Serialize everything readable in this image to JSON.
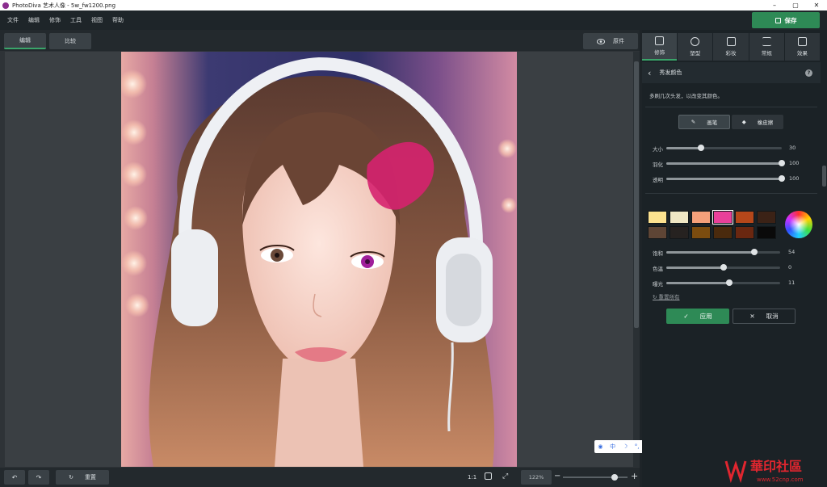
{
  "window": {
    "title": "PhotoDiva 艺术人像 - 5w_fw1200.png",
    "controls": [
      "–",
      "▢",
      "✕"
    ]
  },
  "menu": [
    "文件",
    "编辑",
    "修饰",
    "工具",
    "视图",
    "帮助"
  ],
  "save_label": "保存",
  "view_tabs": [
    "编辑",
    "比较"
  ],
  "original_label": "原件",
  "bottom": {
    "reset_label": "重置",
    "ratio_label": "1:1",
    "zoom_value": "122%",
    "zoom_fraction": 0.8
  },
  "ime": {
    "items": [
      "中",
      "☽",
      "°,",
      "🎤",
      "👤",
      "▦"
    ]
  },
  "tool_tabs": [
    {
      "label": "修饰",
      "icon": "brush-face-icon"
    },
    {
      "label": "塑型",
      "icon": "globe-icon"
    },
    {
      "label": "彩妆",
      "icon": "makeup-icon"
    },
    {
      "label": "常规",
      "icon": "sliders-icon"
    },
    {
      "label": "效果",
      "icon": "effects-icon"
    }
  ],
  "panel": {
    "section_title": "秀发颜色",
    "hint": "多刷几次头发，以改变其颜色。",
    "brush_label": "画笔",
    "eraser_label": "橡皮擦",
    "sliders_top": [
      {
        "label": "大小",
        "value": 30,
        "fraction": 0.3
      },
      {
        "label": "羽化",
        "value": 100,
        "fraction": 1.0
      },
      {
        "label": "透明",
        "value": 100,
        "fraction": 1.0
      }
    ],
    "swatches": [
      "#fce28f",
      "#efe7c4",
      "#f4a07a",
      "#e8409a",
      "#b5471a",
      "#3b2216",
      "#5e4535",
      "#262220",
      "#7b4c0f",
      "#4a2a0d",
      "#6a2710",
      "#0a0a0a"
    ],
    "selected_swatch": 3,
    "sliders_bottom": [
      {
        "label": "饱和",
        "value": 54,
        "fraction": 0.77
      },
      {
        "label": "色温",
        "value": 0,
        "fraction": 0.5
      },
      {
        "label": "曝光",
        "value": 11,
        "fraction": 0.55
      }
    ],
    "reset_all_label": "重置所有",
    "apply_label": "应用",
    "cancel_label": "取消"
  },
  "watermark": {
    "text": "華印社區",
    "url": "www.52cnp.com"
  },
  "colors": {
    "accent": "#2e8a56",
    "highlight": "#3aa56a"
  }
}
